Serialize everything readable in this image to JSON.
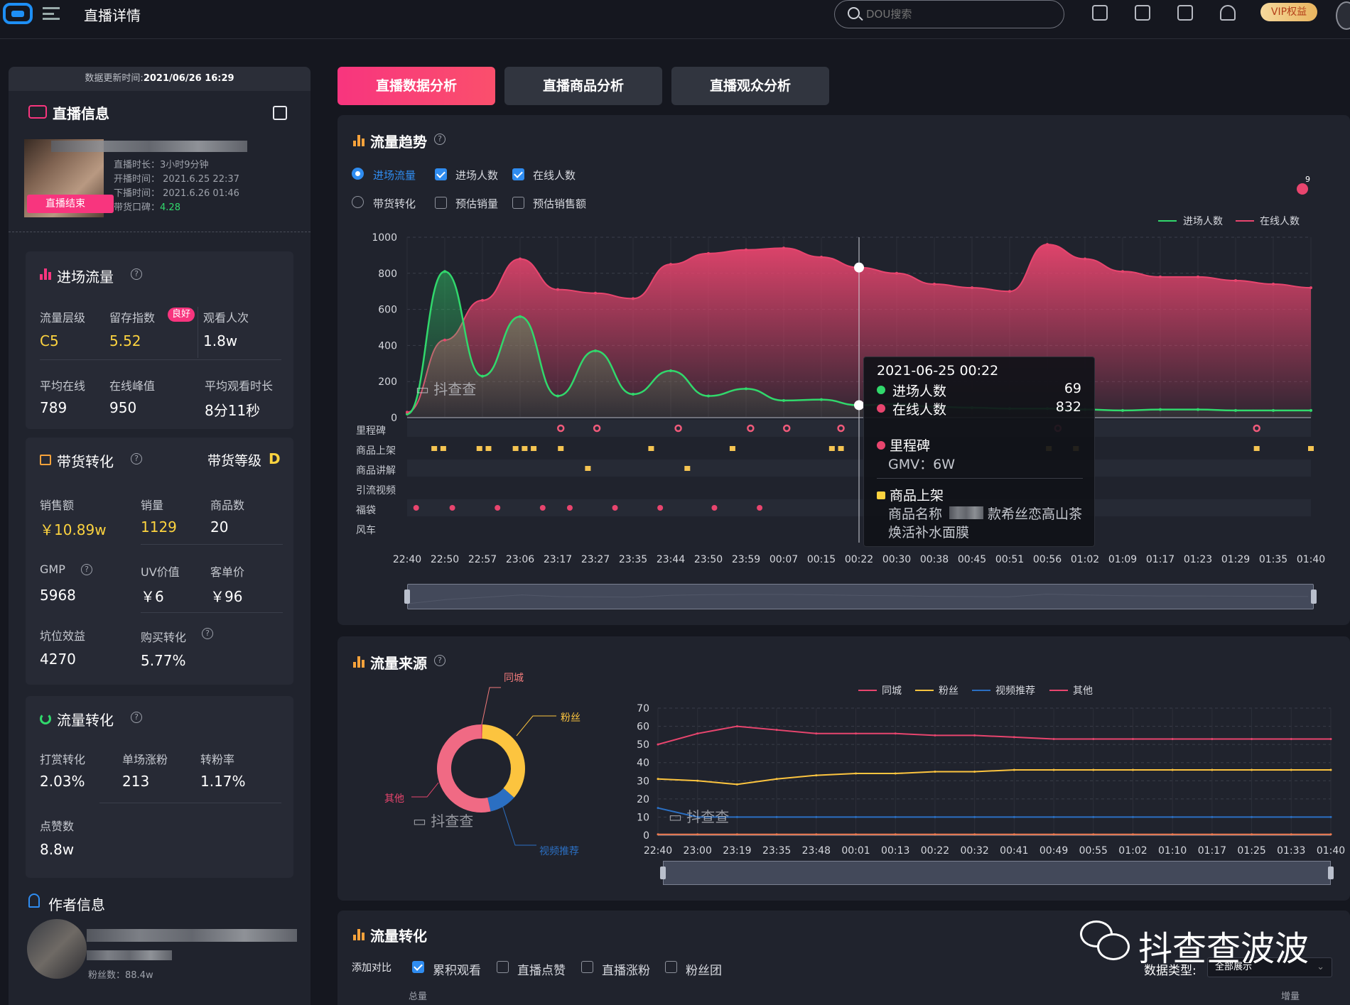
{
  "header": {
    "title": "直播详情",
    "search_placeholder": "DOU搜索",
    "vip_label": "VIP权益"
  },
  "tabs": [
    "直播数据分析",
    "直播商品分析",
    "直播观众分析"
  ],
  "sidebar": {
    "update_time_label": "数据更新时间:",
    "update_time": "2021/06/26 16:29",
    "live_info_title": "直播信息",
    "live_badge": "直播结束",
    "duration": "直播时长：3小时9分钟",
    "start_time": "开播时间： 2021.6.25 22:37",
    "end_time": "下播时间： 2021.6.26 01:46",
    "reputation_label": "带货口碑：",
    "reputation_value": "4.28",
    "traffic": {
      "title": "进场流量",
      "level_label": "流量层级",
      "level_value": "C5",
      "retention_label": "留存指数",
      "retention_badge": "良好",
      "retention_value": "5.52",
      "views_label": "观看人次",
      "views_value": "1.8w",
      "avg_online_label": "平均在线",
      "avg_online_value": "789",
      "peak_label": "在线峰值",
      "peak_value": "950",
      "avg_watch_label": "平均观看时长",
      "avg_watch_value": "8分11秒"
    },
    "sales": {
      "title": "带货转化",
      "grade_label": "带货等级",
      "grade_value": "D",
      "amount_label": "销售额",
      "amount_value": "￥10.89w",
      "volume_label": "销量",
      "volume_value": "1129",
      "products_label": "商品数",
      "products_value": "20",
      "gmp_label": "GMP",
      "gmp_value": "5968",
      "uv_label": "UV价值",
      "uv_value": "￥6",
      "price_label": "客单价",
      "price_value": "￥96",
      "slot_label": "坑位效益",
      "slot_value": "4270",
      "buy_conv_label": "购买转化",
      "buy_conv_value": "5.77%"
    },
    "conversion": {
      "title": "流量转化",
      "reward_label": "打赏转化",
      "reward_value": "2.03%",
      "fans_label": "单场涨粉",
      "fans_value": "213",
      "fan_rate_label": "转粉率",
      "fan_rate_value": "1.17%",
      "likes_label": "点赞数",
      "likes_value": "8.8w"
    },
    "author": {
      "title": "作者信息",
      "fans_label": "粉丝数：88.4w"
    }
  },
  "trend": {
    "title": "流量趋势",
    "options": [
      "进场流量",
      "进场人数",
      "在线人数",
      "带货转化",
      "预估销量",
      "预估销售额"
    ],
    "legend": [
      "进场人数",
      "在线人数"
    ],
    "event_rows": [
      "里程碑",
      "商品上架",
      "商品讲解",
      "引流视频",
      "福袋",
      "风车"
    ],
    "badge_count": "9",
    "watermark": "抖查查",
    "tooltip": {
      "time": "2021-06-25 00:22",
      "entry_label": "进场人数",
      "entry_value": "69",
      "online_label": "在线人数",
      "online_value": "832",
      "milestone_label": "里程碑",
      "milestone_text": "GMV：6W",
      "product_label": "商品上架",
      "product_name_prefix": "商品名称",
      "product_name": "款希丝恋高山茶",
      "product_name_2": "焕活补水面膜"
    }
  },
  "source": {
    "title": "流量来源",
    "legend": [
      "同城",
      "粉丝",
      "视频推荐",
      "其他"
    ],
    "donut_labels": [
      "同城",
      "粉丝",
      "视频推荐",
      "其他"
    ],
    "watermark": "抖查查"
  },
  "flow": {
    "title": "流量转化",
    "compare_label": "添加对比",
    "options": [
      "累积观看",
      "直播点赞",
      "直播涨粉",
      "粉丝团"
    ],
    "data_type_label": "数据类型:",
    "data_type_value": "全部展示",
    "col_total": "总量",
    "col_increment": "增量"
  },
  "wechat_watermark": "抖查查波波",
  "colors": {
    "accent": "#f8357e",
    "entry": "#31d86c",
    "online": "#e8456e",
    "blue": "#2f8cf0",
    "yellow": "#fcd33f"
  },
  "chart_data": [
    {
      "type": "area",
      "title": "流量趋势",
      "x": [
        "22:40",
        "22:50",
        "22:57",
        "23:06",
        "23:17",
        "23:27",
        "23:35",
        "23:44",
        "23:50",
        "23:59",
        "00:07",
        "00:15",
        "00:22",
        "00:30",
        "00:38",
        "00:45",
        "00:51",
        "00:56",
        "01:02",
        "01:09",
        "01:17",
        "01:23",
        "01:29",
        "01:35",
        "01:40"
      ],
      "ylim": [
        0,
        1000
      ],
      "yticks": [
        0,
        200,
        400,
        600,
        800,
        1000
      ],
      "series": [
        {
          "name": "进场人数",
          "values": [
            20,
            810,
            230,
            560,
            120,
            370,
            130,
            260,
            120,
            160,
            95,
            100,
            69,
            75,
            60,
            55,
            50,
            50,
            45,
            40,
            45,
            45,
            40,
            40,
            40
          ]
        },
        {
          "name": "在线人数",
          "values": [
            30,
            430,
            650,
            880,
            710,
            690,
            660,
            850,
            910,
            930,
            940,
            890,
            832,
            800,
            740,
            720,
            700,
            960,
            880,
            810,
            780,
            780,
            760,
            740,
            720
          ]
        }
      ]
    },
    {
      "type": "pie",
      "title": "流量来源",
      "categories": [
        "同城",
        "粉丝",
        "视频推荐",
        "其他"
      ],
      "values": [
        0.5,
        36,
        10,
        53.5
      ]
    },
    {
      "type": "line",
      "title": "流量来源",
      "x": [
        "22:40",
        "23:00",
        "23:19",
        "23:35",
        "23:48",
        "00:01",
        "00:13",
        "00:22",
        "00:32",
        "00:41",
        "00:49",
        "00:55",
        "01:02",
        "01:10",
        "01:17",
        "01:25",
        "01:33",
        "01:40"
      ],
      "ylim": [
        0,
        70
      ],
      "yticks": [
        0,
        10,
        20,
        30,
        40,
        50,
        60,
        70
      ],
      "series": [
        {
          "name": "同城",
          "values": [
            0.5,
            0.5,
            0.5,
            0.5,
            0.5,
            0.5,
            0.5,
            0.5,
            0.5,
            0.5,
            0.5,
            0.5,
            0.5,
            0.5,
            0.5,
            0.5,
            0.5,
            0.5
          ]
        },
        {
          "name": "粉丝",
          "values": [
            31,
            30,
            28,
            31,
            33,
            34,
            34,
            35,
            35,
            36,
            36,
            36,
            36,
            36,
            36,
            36,
            36,
            36
          ]
        },
        {
          "name": "视频推荐",
          "values": [
            15,
            10,
            10,
            10,
            10,
            10,
            10,
            10,
            10,
            10,
            10,
            10,
            10,
            10,
            10,
            10,
            10,
            10
          ]
        },
        {
          "name": "其他",
          "values": [
            50,
            56,
            60,
            58,
            56,
            56,
            56,
            55,
            55,
            54,
            53,
            53,
            53,
            53,
            53,
            53,
            53,
            53
          ]
        }
      ]
    }
  ]
}
